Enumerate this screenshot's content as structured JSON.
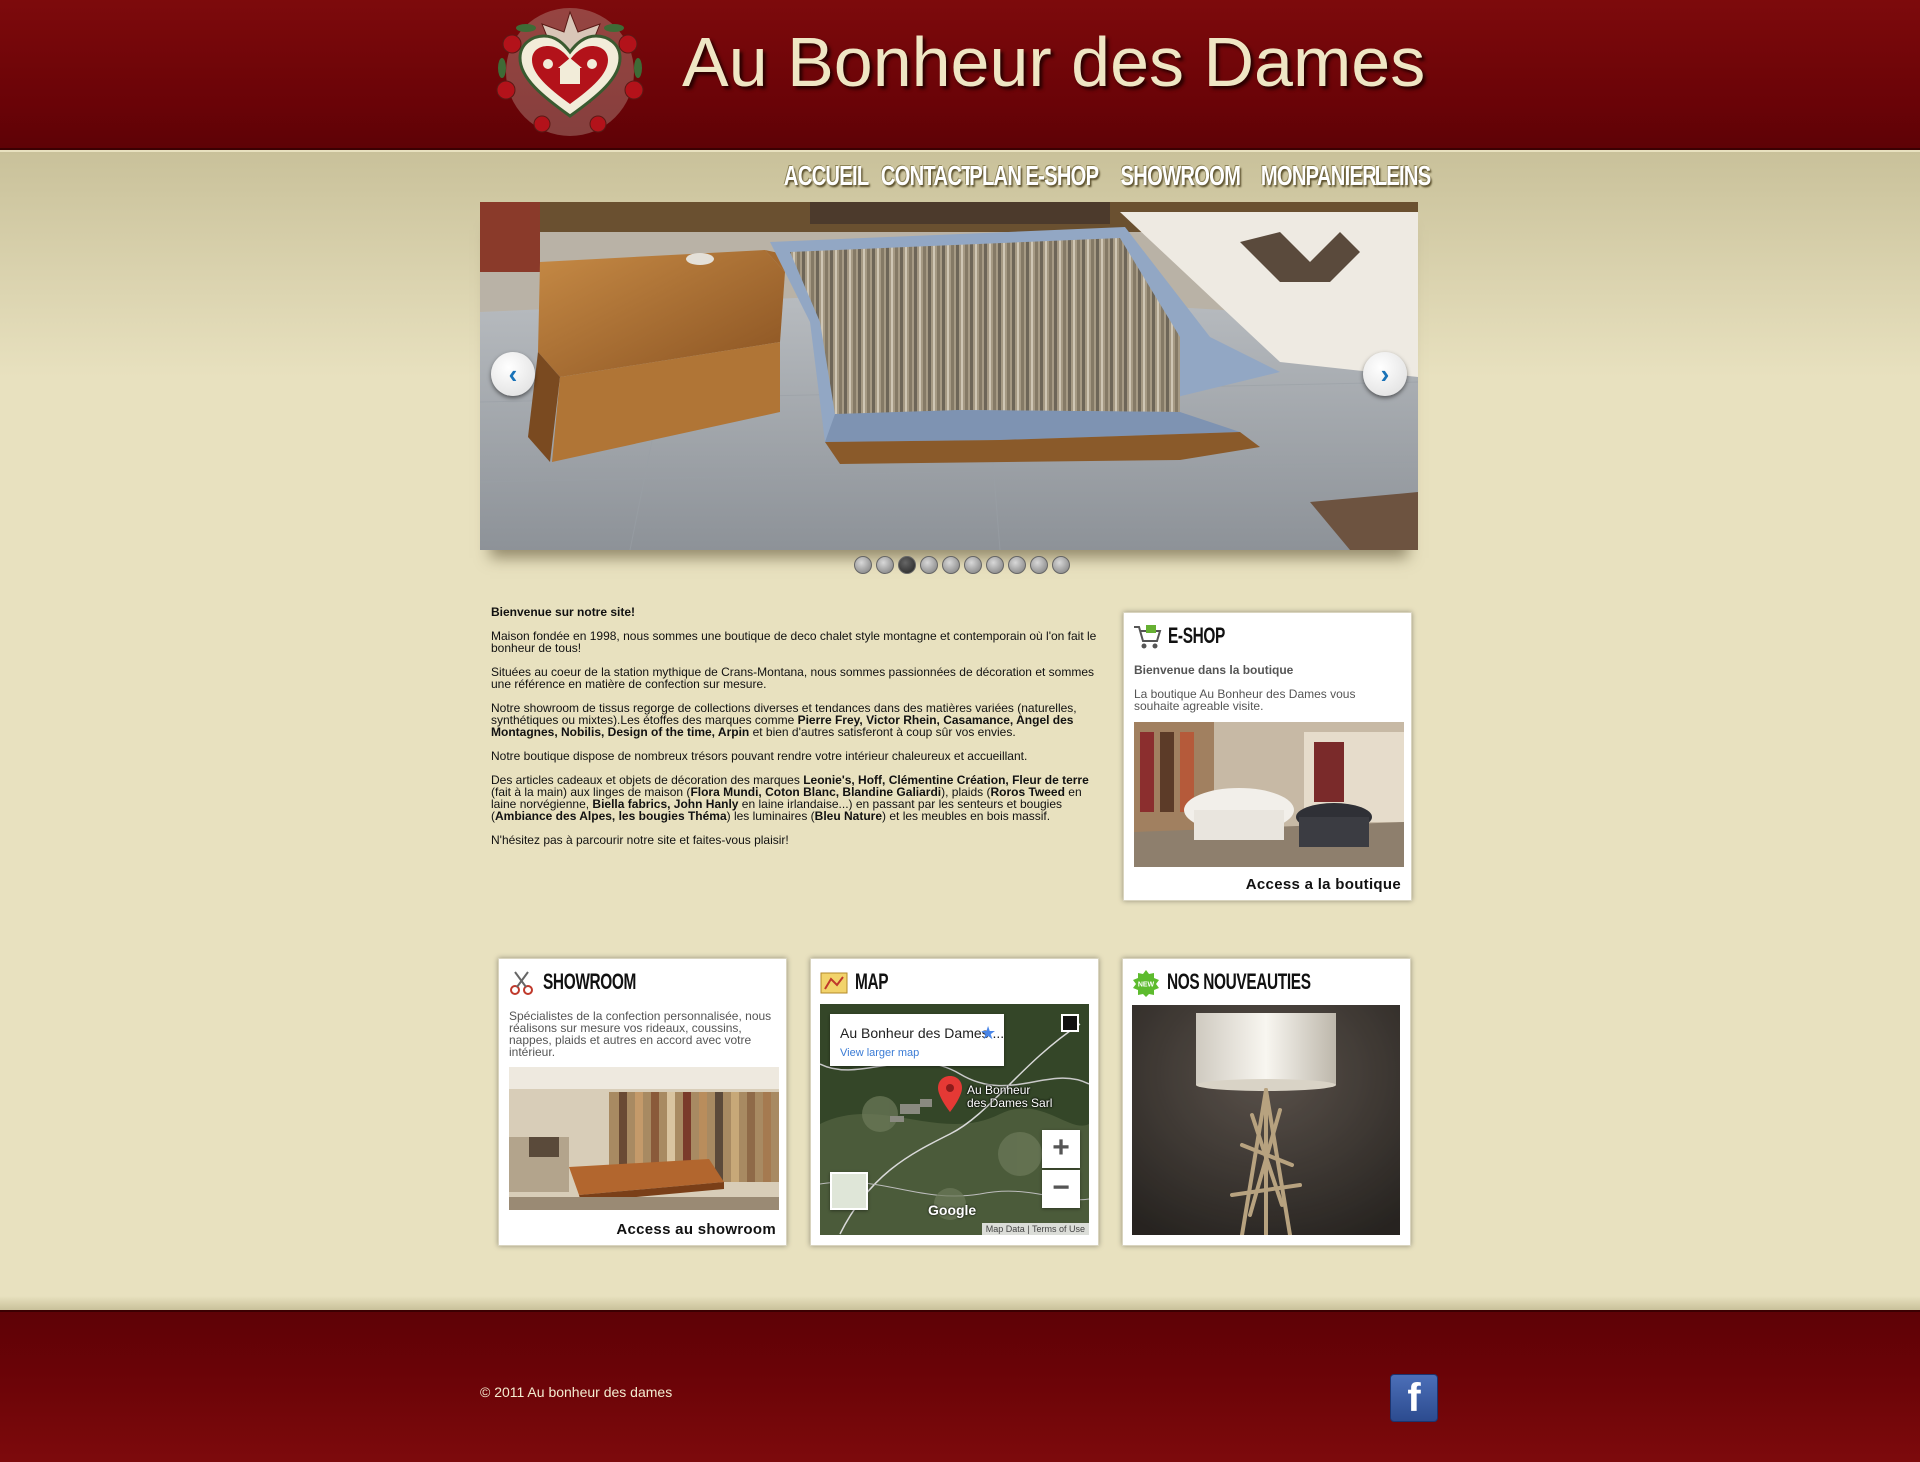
{
  "header": {
    "title": "Au Bonheur des Dames"
  },
  "nav": {
    "items": [
      "ACCUEIL",
      "CONTACT",
      "PLAN",
      "E-SHOP",
      "SHOWROOM",
      "MONPANIER",
      "LEINS"
    ]
  },
  "slider": {
    "total_dots": 10,
    "active_dot": 3
  },
  "welcome": {
    "heading": "Bienvenue sur notre site!",
    "p1": "Maison fondée en 1998, nous sommes une boutique de deco chalet style montagne et contemporain où l'on fait le bonheur de tous!",
    "p2": "Situées au coeur de la station mythique de Crans-Montana, nous sommes passionnées de décoration et sommes une référence en matière de confection sur mesure.",
    "p3_a": "Notre showroom de tissus regorge de collections diverses et tendances dans des matières variées (naturelles, synthétiques ou mixtes).Les étoffes des marques comme ",
    "p3_b": "Pierre Frey, Victor Rhein, Casamance, Angel des Montagnes, Nobilis, Design of the time, Arpin",
    "p3_c": " et bien d'autres satisferont à coup sûr vos envies.",
    "p4": "Notre boutique dispose de nombreux trésors pouvant rendre votre intérieur chaleureux et accueillant.",
    "p5_a": "Des articles cadeaux et objets de décoration des marques ",
    "p5_b": "Leonie's, Hoff, Clémentine Création, Fleur de terre",
    "p5_c": " (fait à la main) aux linges de maison (",
    "p5_d": "Flora Mundi, Coton Blanc, Blandine Galiardi",
    "p5_e": "), plaids (",
    "p5_f": "Roros Tweed",
    "p5_g": " en laine norvégienne, ",
    "p5_h": "Biella fabrics, John Hanly",
    "p5_i": " en laine irlandaise...) en passant par les senteurs et bougies (",
    "p5_j": "Ambiance des Alpes, les bougies Théma",
    "p5_k": ") les luminaires (",
    "p5_l": "Bleu Nature",
    "p5_m": ") et les meubles en bois massif.",
    "p6": "N'hésitez pas à parcourir notre site et faites-vous plaisir!"
  },
  "eshop": {
    "title": "E-SHOP",
    "subtitle": "Bienvenue dans la boutique",
    "text": "La boutique Au Bonheur des Dames vous souhaite agreable visite.",
    "link": "Access a la boutique"
  },
  "showroom": {
    "title": "SHOWROOM",
    "text": "Spécialistes de la confection personnalisée, nous réalisons sur mesure vos rideaux, coussins, nappes, plaids et autres en accord avec votre intérieur.",
    "link": "Access au showroom"
  },
  "map": {
    "title": "MAP",
    "place": "Au Bonheur des Dames ...",
    "larger": "View larger map",
    "pin_label_1": "Au Bonheur",
    "pin_label_2": "des Dames Sarl",
    "zoom_in": "+",
    "zoom_out": "−",
    "map_data": "Map Data",
    "terms": "Terms of Use",
    "google": "Google"
  },
  "nouveautes": {
    "title": "NOS NOUVEAUTIES",
    "badge": "NEW"
  },
  "footer": {
    "copyright": "© 2011 Au bonheur des dames",
    "fb": "f"
  },
  "colors": {
    "header_red": "#6a0307",
    "page_bg": "#e8e1bf",
    "title_cream": "#efe6c4"
  },
  "icons": [
    "heart-logo-icon",
    "cart-icon",
    "scissors-icon",
    "map-icon",
    "new-badge-icon",
    "facebook-icon",
    "chevron-left-icon",
    "chevron-right-icon",
    "map-pin-icon",
    "star-icon",
    "fullscreen-icon"
  ]
}
